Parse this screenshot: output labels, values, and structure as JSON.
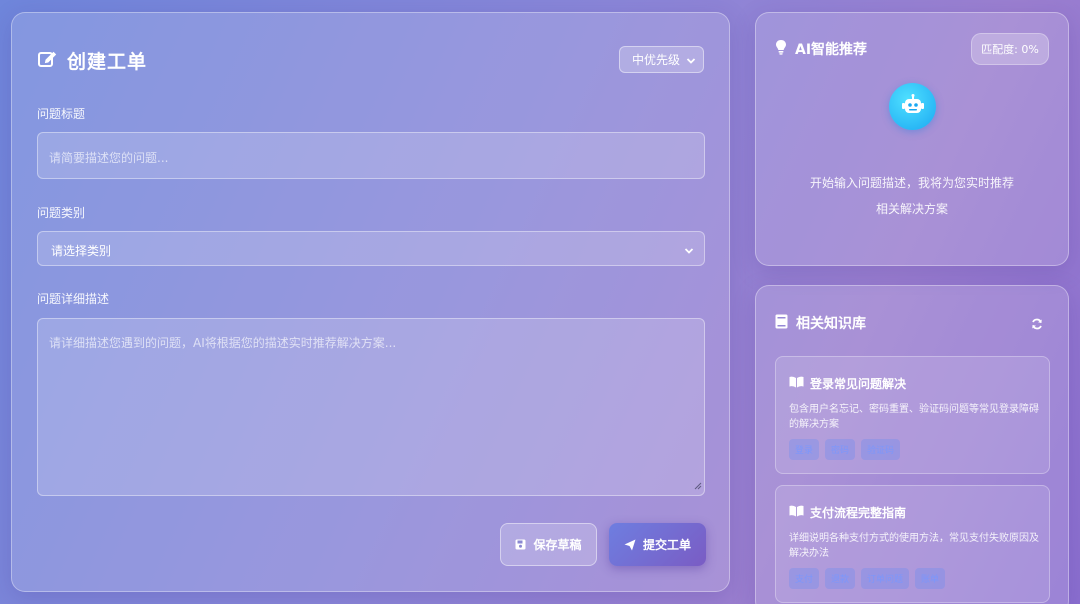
{
  "form": {
    "title": "创建工单",
    "priority": "中优先级",
    "title_label": "问题标题",
    "title_placeholder": "请简要描述您的问题...",
    "category_label": "问题类别",
    "category_value": "请选择类别",
    "detail_label": "问题详细描述",
    "detail_placeholder": "请详细描述您遇到的问题，AI将根据您的描述实时推荐解决方案...",
    "save_label": "保存草稿",
    "submit_label": "提交工单"
  },
  "ai": {
    "title": "AI智能推荐",
    "match": "匹配度: 0%",
    "line1": "开始输入问题描述，我将为您实时推荐",
    "line2": "相关解决方案"
  },
  "kb": {
    "title": "相关知识库",
    "items": [
      {
        "title": "登录常见问题解决",
        "desc": "包含用户名忘记、密码重置、验证码问题等常见登录障碍的解决方案",
        "tags": [
          "登录",
          "密码",
          "验证码"
        ]
      },
      {
        "title": "支付流程完整指南",
        "desc": "详细说明各种支付方式的使用方法，常见支付失败原因及解决办法",
        "tags": [
          "支付",
          "退款",
          "订单问题",
          "账单"
        ]
      }
    ]
  }
}
